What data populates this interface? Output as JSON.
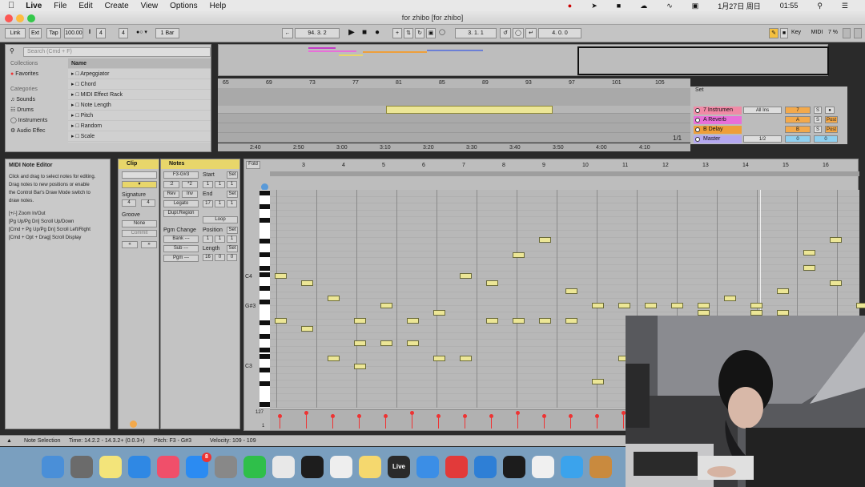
{
  "menubar": {
    "app": "Live",
    "items": [
      "File",
      "Edit",
      "Create",
      "View",
      "Options",
      "Help"
    ],
    "date": "1月27日 周日",
    "time": "01:55"
  },
  "window": {
    "title": "for zhibo  [for zhibo]"
  },
  "control_bar": {
    "link": "Link",
    "ext": "Ext",
    "tap": "Tap",
    "tempo": "100.00",
    "sig_num": "4",
    "sig_den": "4",
    "quant": "1 Bar",
    "position": "94.   3.   2",
    "loop_start": "3.   1.   1",
    "loop_len": "4.   0.   0",
    "key": "Key",
    "midi": "MIDI",
    "cpu": "7 %"
  },
  "browser": {
    "search_placeholder": "Search (Cmd + F)",
    "collections_label": "Collections",
    "favorites": "Favorites",
    "categories_label": "Categories",
    "categories": [
      "Sounds",
      "Drums",
      "Instruments",
      "Audio Effec"
    ],
    "name_header": "Name",
    "items": [
      "Arpeggiator",
      "Chord",
      "MIDI Effect Rack",
      "Note Length",
      "Pitch",
      "Random",
      "Scale"
    ]
  },
  "arrangement": {
    "bars": [
      "65",
      "69",
      "73",
      "77",
      "81",
      "85",
      "89",
      "93",
      "97",
      "101",
      "105"
    ],
    "times": [
      "2:40",
      "2:50",
      "3:00",
      "3:10",
      "3:20",
      "3:30",
      "3:40",
      "3:50",
      "4:00",
      "4:10"
    ],
    "page": "1/1"
  },
  "mixer": {
    "set_label": "Set",
    "tracks": [
      {
        "name": "7 Instrumen",
        "color": "#f08aa6",
        "input": "All Ins",
        "num": "7",
        "s": "S",
        "extra": ""
      },
      {
        "name": "A Reverb",
        "color": "#e86fd8",
        "input": "",
        "num": "A",
        "s": "S",
        "extra": "Post"
      },
      {
        "name": "B Delay",
        "color": "#ee9f3a",
        "input": "",
        "num": "B",
        "s": "S",
        "extra": "Post"
      },
      {
        "name": "Master",
        "color": "#b4a8f0",
        "input": "1/2",
        "num": "0",
        "s": "",
        "extra": "0"
      }
    ]
  },
  "help": {
    "title": "MIDI Note Editor",
    "lines": [
      "Click and drag to select notes for editing.",
      "Drag notes to new positions or enable",
      "the Control Bar's Draw Mode switch to",
      "draw notes.",
      "",
      "[+/-] Zoom In/Out",
      "[Pg Up/Pg Dn] Scroll Up/Down",
      "[Cmd + Pg Up/Pg Dn] Scroll Left/Right",
      "[Cmd + Opt + Drag] Scroll Display"
    ]
  },
  "clip": {
    "header": "Clip",
    "signature_label": "Signature",
    "sig_num": "4",
    "sig_den": "4",
    "groove_label": "Groove",
    "groove_value": "None",
    "commit": "Commit"
  },
  "notes": {
    "header": "Notes",
    "range": "F3-G#3",
    "div2": ":2",
    "mul2": "*2",
    "rev": "Rev",
    "inv": "Inv",
    "legato": "Legato",
    "dupl": "Dupl.Region",
    "start_label": "Start",
    "end_label": "End",
    "set": "Set",
    "loop": "Loop",
    "pgm_label": "Pgm Change",
    "position_label": "Position",
    "length_label": "Length",
    "bank": "Bank ---",
    "sub": "Sub ---",
    "pgm": "Pgm ---",
    "start_vals": [
      "1",
      "1",
      "1"
    ],
    "end_vals": [
      "17",
      "1",
      "1"
    ],
    "pos_vals": [
      "1",
      "1",
      "1"
    ],
    "len_vals": [
      "16",
      "0",
      "0"
    ]
  },
  "pianoroll": {
    "fold": "Fold",
    "bars": [
      "3",
      "4",
      "5",
      "6",
      "7",
      "8",
      "9",
      "10",
      "11",
      "12",
      "13",
      "14",
      "15",
      "16"
    ],
    "labels": {
      "c4": "C4",
      "gs3": "G#3",
      "c3": "C3"
    },
    "vel_top": "127",
    "vel_bot": "1"
  },
  "status": {
    "selection": "Note Selection",
    "time": "Time: 14.2.2 - 14.3.2+ (0.0.3+)",
    "pitch": "Pitch: F3 - G#3",
    "velocity": "Velocity: 109 - 109"
  },
  "dock": {
    "icons": [
      "finder-icon",
      "launchpad-icon",
      "notes-icon",
      "safari-icon",
      "music-icon",
      "appstore-icon",
      "settings-icon",
      "wechat-icon",
      "chrome-icon",
      "qq-icon",
      "pages-icon",
      "stickies-icon",
      "live-icon",
      "bird-icon",
      "netease-icon",
      "baidu-icon",
      "terminal-icon",
      "itunes-icon",
      "video-icon",
      "speaker-icon"
    ],
    "appstore_badge": "8",
    "live_label": "Live"
  },
  "colors": {
    "clip_yellow": "#e8d66a",
    "note": "#ece696",
    "velocity": "#e33333"
  }
}
